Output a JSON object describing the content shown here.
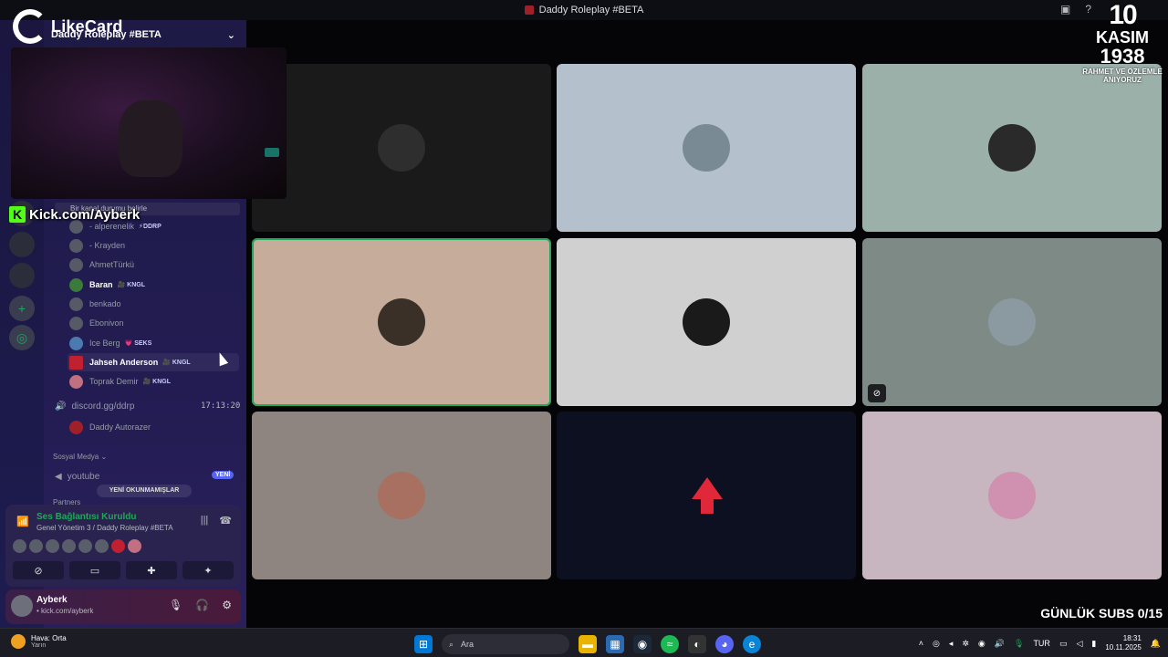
{
  "titlebar": {
    "title": "Daddy Roleplay #BETA",
    "icons": [
      "screen-share-icon",
      "help-icon",
      "inbox-icon"
    ]
  },
  "server": {
    "name": "Daddy Roleplay #BETA"
  },
  "overlay": {
    "likecard": "LikeCard",
    "kick": "Kick.com/Ayberk",
    "kasim": {
      "line1": "10",
      "line2": "KASIM",
      "line3": "1938",
      "line4": "RAHMET VE ÖZLEMLE",
      "line5": "ANIYORUZ"
    },
    "subs": "GÜNLÜK SUBS 0/15"
  },
  "channel_status": "Bir kanal durumu belirle",
  "members": [
    {
      "name": "- alperenelik",
      "tag": "⚡DDRP",
      "highlight": false
    },
    {
      "name": "- Krayden",
      "tag": "",
      "highlight": false
    },
    {
      "name": "AhmetTürkü",
      "tag": "",
      "highlight": false
    },
    {
      "name": "Baran",
      "tag": "🎥 KNGL",
      "highlight": true
    },
    {
      "name": "benkado",
      "tag": "",
      "highlight": false
    },
    {
      "name": "Ebonivon",
      "tag": "",
      "highlight": false
    },
    {
      "name": "Ice Berg",
      "tag": "💗 SEKS",
      "highlight": false
    },
    {
      "name": "Jahseh Anderson",
      "tag": "🎥 KNGL",
      "highlight": true
    },
    {
      "name": "Toprak Demir",
      "tag": "🎥 KNGL",
      "highlight": false
    }
  ],
  "voice_channel2": {
    "name": "discord.gg/ddrp",
    "time": "17:13:20",
    "member": "Daddy Autorazer"
  },
  "category": {
    "name": "Sosyal Medya",
    "channel": "youtube",
    "badge": "YENİ"
  },
  "unread": "YENİ OKUNMAMIŞLAR",
  "partners": "Partners",
  "voice_panel": {
    "title": "Ses Bağlantısı Kuruldu",
    "subtitle": "Genel Yönetim 3 / Daddy Roleplay #BETA"
  },
  "user": {
    "name": "Ayberk",
    "status": "• kick.com/ayberk"
  },
  "tiles": [
    {
      "bg": "#1a1a1a",
      "avatar": "#2e2e2e"
    },
    {
      "bg": "#b4c0cb",
      "avatar": "#7a8a94"
    },
    {
      "bg": "#9cb0aa",
      "avatar": "#2a2a2a"
    },
    {
      "bg": "#c6ac9a",
      "avatar": "#3a3028"
    },
    {
      "bg": "#d0d0d0",
      "avatar": "#1a1a1a"
    },
    {
      "bg": "#7e8a85",
      "avatar": "#8a9aa0"
    },
    {
      "bg": "#8e8480",
      "avatar": "#a87060"
    },
    {
      "bg": "#0c1020",
      "avatar": "#e0283a"
    },
    {
      "bg": "#c7b5c0",
      "avatar": "#d090b0"
    }
  ],
  "taskbar": {
    "weather_title": "Hava: Orta",
    "weather_sub": "Yarın",
    "search": "Ara",
    "lang": "TUR",
    "time": "18:31",
    "date": "10.11.2025"
  }
}
